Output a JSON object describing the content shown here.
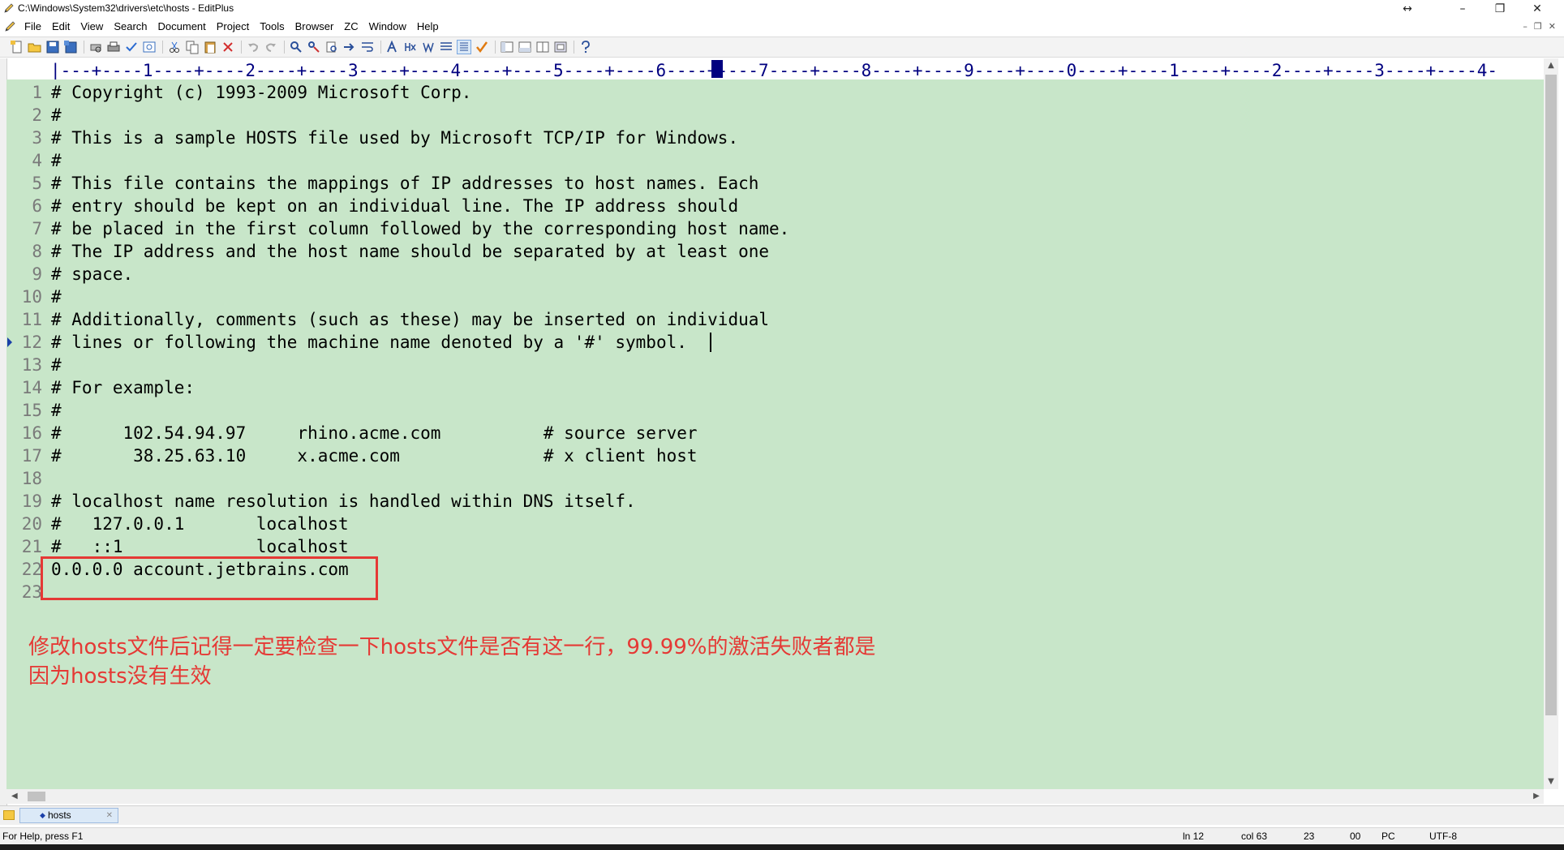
{
  "window": {
    "title": "C:\\Windows\\System32\\drivers\\etc\\hosts - EditPlus",
    "resize_glyph": "↔",
    "minimize_glyph": "–",
    "restore_glyph": "❐",
    "close_glyph": "✕"
  },
  "menu": {
    "items": [
      "File",
      "Edit",
      "View",
      "Search",
      "Document",
      "Project",
      "Tools",
      "Browser",
      "ZC",
      "Window",
      "Help"
    ],
    "mdi_minimize": "–",
    "mdi_restore": "❐",
    "mdi_close": "✕"
  },
  "toolbar": {
    "icons": [
      "new-file-icon",
      "open-icon",
      "save-icon",
      "save-all-icon",
      "print-preview-icon",
      "print-icon",
      "spell-check-icon",
      "browser-icon",
      "cut-icon",
      "copy-icon",
      "paste-icon",
      "delete-icon",
      "undo-icon",
      "redo-icon",
      "find-icon",
      "replace-icon",
      "find-in-files-icon",
      "goto-icon",
      "word-wrap-icon",
      "hex-icon",
      "font-icon",
      "indent-icon",
      "column-select-icon",
      "check-icon",
      "cliptext-icon",
      "directory-icon",
      "output-icon",
      "split-icon",
      "help-icon"
    ]
  },
  "ruler": {
    "text": "|---+----1----+----2----+----3----+----4----+----5----+----6----+----7----+----8----+----9----+----0----+----1----+----2----+----3----+----4-"
  },
  "editor": {
    "lines": [
      {
        "n": "1",
        "text": "# Copyright (c) 1993-2009 Microsoft Corp."
      },
      {
        "n": "2",
        "text": "#"
      },
      {
        "n": "3",
        "text": "# This is a sample HOSTS file used by Microsoft TCP/IP for Windows."
      },
      {
        "n": "4",
        "text": "#"
      },
      {
        "n": "5",
        "text": "# This file contains the mappings of IP addresses to host names. Each"
      },
      {
        "n": "6",
        "text": "# entry should be kept on an individual line. The IP address should"
      },
      {
        "n": "7",
        "text": "# be placed in the first column followed by the corresponding host name."
      },
      {
        "n": "8",
        "text": "# The IP address and the host name should be separated by at least one"
      },
      {
        "n": "9",
        "text": "# space."
      },
      {
        "n": "10",
        "text": "#"
      },
      {
        "n": "11",
        "text": "# Additionally, comments (such as these) may be inserted on individual"
      },
      {
        "n": "12",
        "text": "# lines or following the machine name denoted by a '#' symbol."
      },
      {
        "n": "13",
        "text": "#"
      },
      {
        "n": "14",
        "text": "# For example:"
      },
      {
        "n": "15",
        "text": "#"
      },
      {
        "n": "16",
        "text": "#      102.54.94.97     rhino.acme.com          # source server"
      },
      {
        "n": "17",
        "text": "#       38.25.63.10     x.acme.com              # x client host"
      },
      {
        "n": "18",
        "text": ""
      },
      {
        "n": "19",
        "text": "# localhost name resolution is handled within DNS itself."
      },
      {
        "n": "20",
        "text": "#   127.0.0.1       localhost"
      },
      {
        "n": "21",
        "text": "#   ::1             localhost"
      },
      {
        "n": "22",
        "text": "0.0.0.0 account.jetbrains.com"
      },
      {
        "n": "23",
        "text": ""
      }
    ],
    "note_line1": "修改hosts文件后记得一定要检查一下hosts文件是否有这一行，99.99%的激活失败者都是",
    "note_line2": "因为hosts没有生效",
    "highlight_color": "#e53935",
    "background_color": "#c8e6c9"
  },
  "tabs": [
    {
      "label": "hosts",
      "active": true,
      "close_glyph": "✕"
    }
  ],
  "status": {
    "help": "For Help, press F1",
    "line": "ln 12",
    "col": "col 63",
    "total": "23",
    "hex": "00",
    "mode": "PC",
    "encoding": "UTF-8"
  }
}
